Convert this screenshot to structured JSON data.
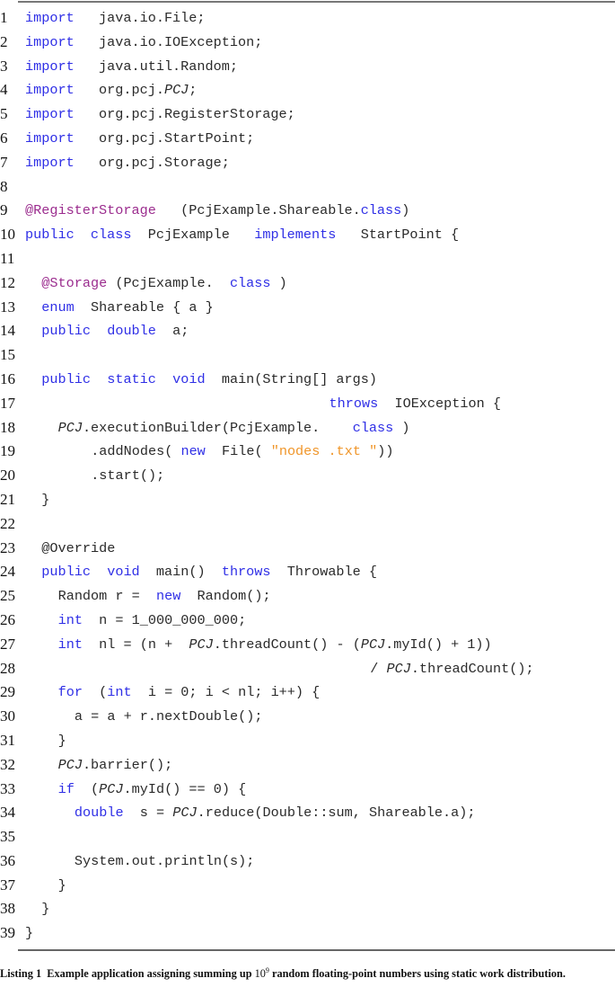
{
  "listing": {
    "lines": [
      {
        "n": "1",
        "indent": 0,
        "tokens": [
          {
            "t": "import",
            "c": "kw"
          },
          {
            "t": "   java.io.File;"
          }
        ]
      },
      {
        "n": "2",
        "indent": 0,
        "tokens": [
          {
            "t": "import",
            "c": "kw"
          },
          {
            "t": "   java.io.IOException;"
          }
        ]
      },
      {
        "n": "3",
        "indent": 0,
        "tokens": [
          {
            "t": "import",
            "c": "kw"
          },
          {
            "t": "   java.util.Random;"
          }
        ]
      },
      {
        "n": "4",
        "indent": 0,
        "tokens": [
          {
            "t": "import",
            "c": "kw"
          },
          {
            "t": "   org.pcj."
          },
          {
            "t": "PCJ",
            "c": "it"
          },
          {
            "t": ";"
          }
        ]
      },
      {
        "n": "5",
        "indent": 0,
        "tokens": [
          {
            "t": "import",
            "c": "kw"
          },
          {
            "t": "   org.pcj.RegisterStorage;"
          }
        ]
      },
      {
        "n": "6",
        "indent": 0,
        "tokens": [
          {
            "t": "import",
            "c": "kw"
          },
          {
            "t": "   org.pcj.StartPoint;"
          }
        ]
      },
      {
        "n": "7",
        "indent": 0,
        "tokens": [
          {
            "t": "import",
            "c": "kw"
          },
          {
            "t": "   org.pcj.Storage;"
          }
        ]
      },
      {
        "n": "8",
        "indent": 0,
        "tokens": []
      },
      {
        "n": "9",
        "indent": 0,
        "tokens": [
          {
            "t": "@RegisterStorage",
            "c": "ann"
          },
          {
            "t": "   (PcjExample.Shareable."
          },
          {
            "t": "class",
            "c": "kw"
          },
          {
            "t": ")"
          }
        ]
      },
      {
        "n": "10",
        "indent": 0,
        "tokens": [
          {
            "t": "public",
            "c": "kw"
          },
          {
            "t": "  "
          },
          {
            "t": "class",
            "c": "kw"
          },
          {
            "t": "  PcjExample   "
          },
          {
            "t": "implements",
            "c": "kw"
          },
          {
            "t": "   StartPoint {"
          }
        ]
      },
      {
        "n": "11",
        "indent": 0,
        "tokens": []
      },
      {
        "n": "12",
        "indent": 2,
        "tokens": [
          {
            "t": "@Storage",
            "c": "ann"
          },
          {
            "t": " (PcjExample.  "
          },
          {
            "t": "class",
            "c": "kw"
          },
          {
            "t": " )"
          }
        ]
      },
      {
        "n": "13",
        "indent": 2,
        "tokens": [
          {
            "t": "enum",
            "c": "kw"
          },
          {
            "t": "  Shareable { a }"
          }
        ]
      },
      {
        "n": "14",
        "indent": 2,
        "tokens": [
          {
            "t": "public",
            "c": "kw"
          },
          {
            "t": "  "
          },
          {
            "t": "double",
            "c": "kw"
          },
          {
            "t": "  a;"
          }
        ]
      },
      {
        "n": "15",
        "indent": 0,
        "tokens": []
      },
      {
        "n": "16",
        "indent": 2,
        "tokens": [
          {
            "t": "public",
            "c": "kw"
          },
          {
            "t": "  "
          },
          {
            "t": "static",
            "c": "kw"
          },
          {
            "t": "  "
          },
          {
            "t": "void",
            "c": "kw"
          },
          {
            "t": "  main(String[] args)"
          }
        ]
      },
      {
        "n": "17",
        "indent": 37,
        "tokens": [
          {
            "t": "throws",
            "c": "kw"
          },
          {
            "t": "  IOException {"
          }
        ]
      },
      {
        "n": "18",
        "indent": 4,
        "tokens": [
          {
            "t": "PCJ",
            "c": "it"
          },
          {
            "t": ".executionBuilder(PcjExample.    "
          },
          {
            "t": "class",
            "c": "kw"
          },
          {
            "t": " )"
          }
        ]
      },
      {
        "n": "19",
        "indent": 8,
        "tokens": [
          {
            "t": ".addNodes( "
          },
          {
            "t": "new",
            "c": "kw"
          },
          {
            "t": "  File( "
          },
          {
            "t": "\"nodes .txt \"",
            "c": "str"
          },
          {
            "t": "))"
          }
        ]
      },
      {
        "n": "20",
        "indent": 8,
        "tokens": [
          {
            "t": ".start();"
          }
        ]
      },
      {
        "n": "21",
        "indent": 2,
        "tokens": [
          {
            "t": "}"
          }
        ]
      },
      {
        "n": "22",
        "indent": 0,
        "tokens": []
      },
      {
        "n": "23",
        "indent": 2,
        "tokens": [
          {
            "t": "@Override"
          }
        ]
      },
      {
        "n": "24",
        "indent": 2,
        "tokens": [
          {
            "t": "public",
            "c": "kw"
          },
          {
            "t": "  "
          },
          {
            "t": "void",
            "c": "kw"
          },
          {
            "t": "  main()  "
          },
          {
            "t": "throws",
            "c": "kw"
          },
          {
            "t": "  Throwable {"
          }
        ]
      },
      {
        "n": "25",
        "indent": 4,
        "tokens": [
          {
            "t": "Random r =  "
          },
          {
            "t": "new",
            "c": "kw"
          },
          {
            "t": "  Random();"
          }
        ]
      },
      {
        "n": "26",
        "indent": 4,
        "tokens": [
          {
            "t": "int",
            "c": "kw"
          },
          {
            "t": "  n = 1_000_000_000;"
          }
        ]
      },
      {
        "n": "27",
        "indent": 4,
        "tokens": [
          {
            "t": "int",
            "c": "kw"
          },
          {
            "t": "  nl = (n +  "
          },
          {
            "t": "PCJ",
            "c": "it"
          },
          {
            "t": ".threadCount() - ("
          },
          {
            "t": "PCJ",
            "c": "it"
          },
          {
            "t": ".myId() + 1))"
          }
        ]
      },
      {
        "n": "28",
        "indent": 42,
        "tokens": [
          {
            "t": "/ "
          },
          {
            "t": "PCJ",
            "c": "it"
          },
          {
            "t": ".threadCount();"
          }
        ]
      },
      {
        "n": "29",
        "indent": 4,
        "tokens": [
          {
            "t": "for",
            "c": "kw"
          },
          {
            "t": "  ("
          },
          {
            "t": "int",
            "c": "kw"
          },
          {
            "t": "  i = 0; i < nl; i++) {"
          }
        ]
      },
      {
        "n": "30",
        "indent": 6,
        "tokens": [
          {
            "t": "a = a + r.nextDouble();"
          }
        ]
      },
      {
        "n": "31",
        "indent": 4,
        "tokens": [
          {
            "t": "}"
          }
        ]
      },
      {
        "n": "32",
        "indent": 4,
        "tokens": [
          {
            "t": "PCJ",
            "c": "it"
          },
          {
            "t": ".barrier();"
          }
        ]
      },
      {
        "n": "33",
        "indent": 4,
        "tokens": [
          {
            "t": "if",
            "c": "kw"
          },
          {
            "t": "  ("
          },
          {
            "t": "PCJ",
            "c": "it"
          },
          {
            "t": ".myId() == 0) {"
          }
        ]
      },
      {
        "n": "34",
        "indent": 6,
        "tokens": [
          {
            "t": "double",
            "c": "kw"
          },
          {
            "t": "  s = "
          },
          {
            "t": "PCJ",
            "c": "it"
          },
          {
            "t": ".reduce(Double::sum, Shareable.a);"
          }
        ]
      },
      {
        "n": "35",
        "indent": 0,
        "tokens": []
      },
      {
        "n": "36",
        "indent": 6,
        "tokens": [
          {
            "t": "System.out.println(s);"
          }
        ]
      },
      {
        "n": "37",
        "indent": 4,
        "tokens": [
          {
            "t": "}"
          }
        ]
      },
      {
        "n": "38",
        "indent": 2,
        "tokens": [
          {
            "t": "}"
          }
        ]
      },
      {
        "n": "39",
        "indent": 0,
        "tokens": [
          {
            "t": "}"
          }
        ]
      }
    ]
  },
  "caption": {
    "label": "Listing 1",
    "text_before": "Example application assigning summing up ",
    "math_base": "10",
    "math_exp": "9",
    "text_after": " random floating-point numbers using static work distribution."
  },
  "colors": {
    "keyword": "#2f2fe6",
    "annotation": "#9b2c8e",
    "string": "#f0962a",
    "text": "#2a2a2a"
  }
}
